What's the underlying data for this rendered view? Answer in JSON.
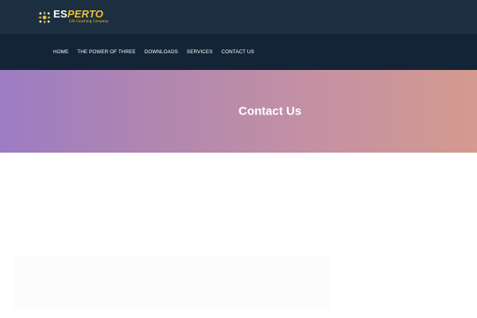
{
  "brand": {
    "word_start": "ES",
    "word_end": "PERTO",
    "tagline": "Life Coaching Company",
    "icon": "logo-mark-icon",
    "accent_color": "#f2c230"
  },
  "nav": {
    "items": [
      {
        "label": "HOME"
      },
      {
        "label": "THE POWER OF THREE"
      },
      {
        "label": "DOWNLOADS"
      },
      {
        "label": "SERVICES"
      },
      {
        "label": "CONTACT US"
      }
    ]
  },
  "hero": {
    "title": "Contact Us",
    "gradient_start": "#9c7cc2",
    "gradient_end": "#d49a8f"
  },
  "colors": {
    "topbar": "#1b2f40",
    "navbar": "#132436"
  }
}
